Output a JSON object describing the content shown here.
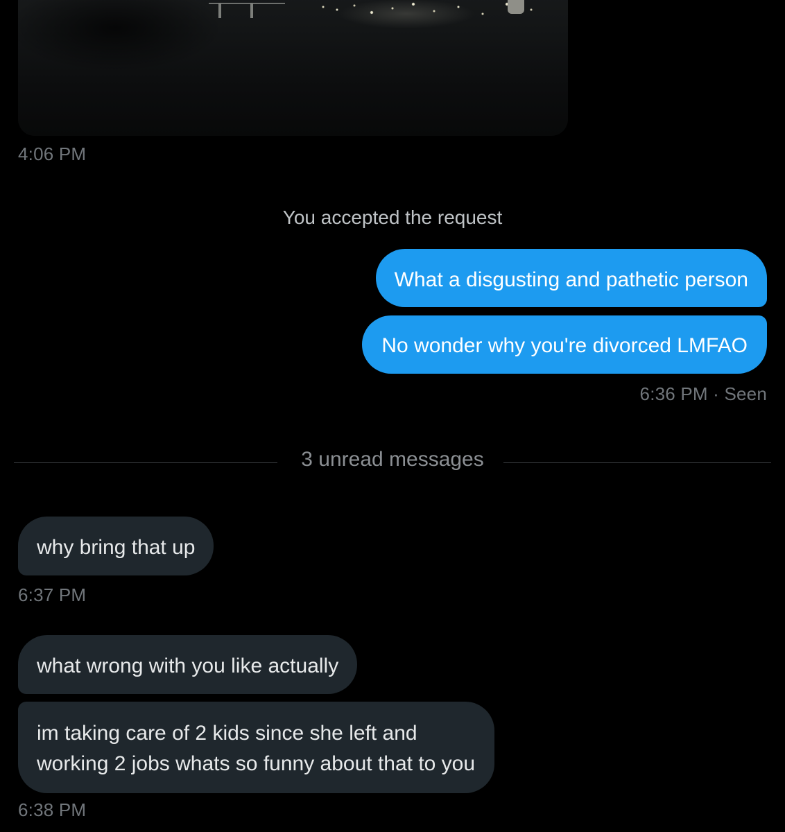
{
  "image_message": {
    "timestamp": "4:06 PM"
  },
  "system_note": "You accepted the request",
  "sent_messages": [
    {
      "text": "What a disgusting and pathetic person"
    },
    {
      "text": "No wonder why you're divorced LMFAO"
    }
  ],
  "sent_status": "6:36 PM · Seen",
  "unread_divider": "3 unread messages",
  "received_group_1": {
    "messages": [
      {
        "text": "why bring that up"
      }
    ],
    "timestamp": "6:37 PM"
  },
  "received_group_2": {
    "messages": [
      {
        "text": "what wrong with you like actually"
      },
      {
        "line1": "im taking care of 2 kids since she left and",
        "line2": "working 2 jobs whats so funny about that to you"
      }
    ],
    "timestamp": "6:38 PM"
  },
  "colors": {
    "background": "#000000",
    "sent_bubble": "#1d9bf0",
    "received_bubble": "#1f272d",
    "timestamp": "#71767b"
  }
}
